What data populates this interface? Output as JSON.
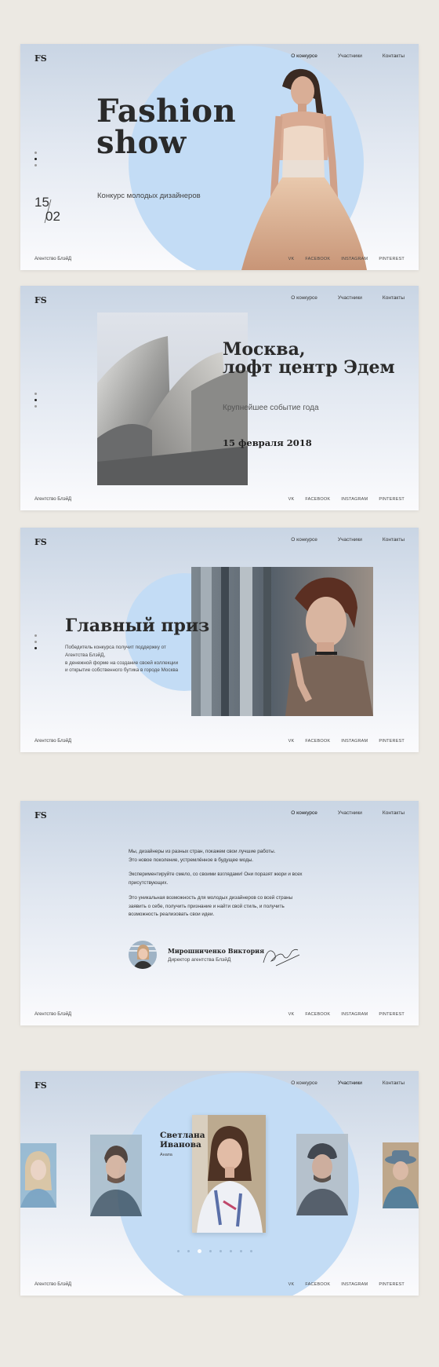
{
  "brand": {
    "logo": "FS",
    "agency": "Агентство БлэйД"
  },
  "social": [
    "VK",
    "FACEBOOK",
    "INSTAGRAM",
    "PINTEREST"
  ],
  "colors": {
    "background": "#ece9e3",
    "accent_circle": "#c3dcf5",
    "text": "#2a2a2a"
  },
  "slides": [
    {
      "nav": [
        "О конкурсе",
        "Участники",
        "Контакты"
      ],
      "title_line1": "Fashion",
      "title_line2": "show",
      "subtitle": "Конкурс молодых дизайнеров",
      "date_day": "15",
      "date_month": "02"
    },
    {
      "nav": [
        "О конкурсе",
        "Участники",
        "Контакты"
      ],
      "title_line1": "Москва,",
      "title_line2": "лофт центр Эдем",
      "subtitle": "Крупнейшее событие года",
      "date": "15 февраля 2018"
    },
    {
      "nav": [
        "О конкурсе",
        "Участники",
        "Контакты"
      ],
      "title": "Главный приз",
      "text_line1": "Победитель конкурса получит поддержку от",
      "text_line2": "Агентства БлэйД,",
      "text_line3": "в денежной форме на создание своей коллекции",
      "text_line4": "и открытие собственного бутика в городе Москва"
    },
    {
      "nav": [
        "О конкурсе",
        "Участники",
        "Контакты"
      ],
      "para1_line1": "Мы, дизайнеры из разных стран, покажем свои лучшие работы.",
      "para1_line2": "Это новое поколение, устремлённое в будущее моды.",
      "para2_line1": "Экспериментируйте смело, со своими взглядами! Они поразят жюри и всех",
      "para2_line2": "присутствующих.",
      "para3_line1": "Это уникальная возможность для молодых дизайнеров со всей страны",
      "para3_line2": "заявить о себе, получить признание и найти свой стиль, и получить",
      "para3_line3": "возможность реализовать свои идеи.",
      "author_name": "Мирошниченко Виктория",
      "author_role": "Директор агентства БлэйД"
    },
    {
      "nav": [
        "О конкурсе",
        "Участники",
        "Контакты"
      ],
      "participant_first": "Светлана",
      "participant_last": "Иванова",
      "participant_city": "Анапа",
      "carousel_total": 8,
      "carousel_active": 3
    }
  ]
}
